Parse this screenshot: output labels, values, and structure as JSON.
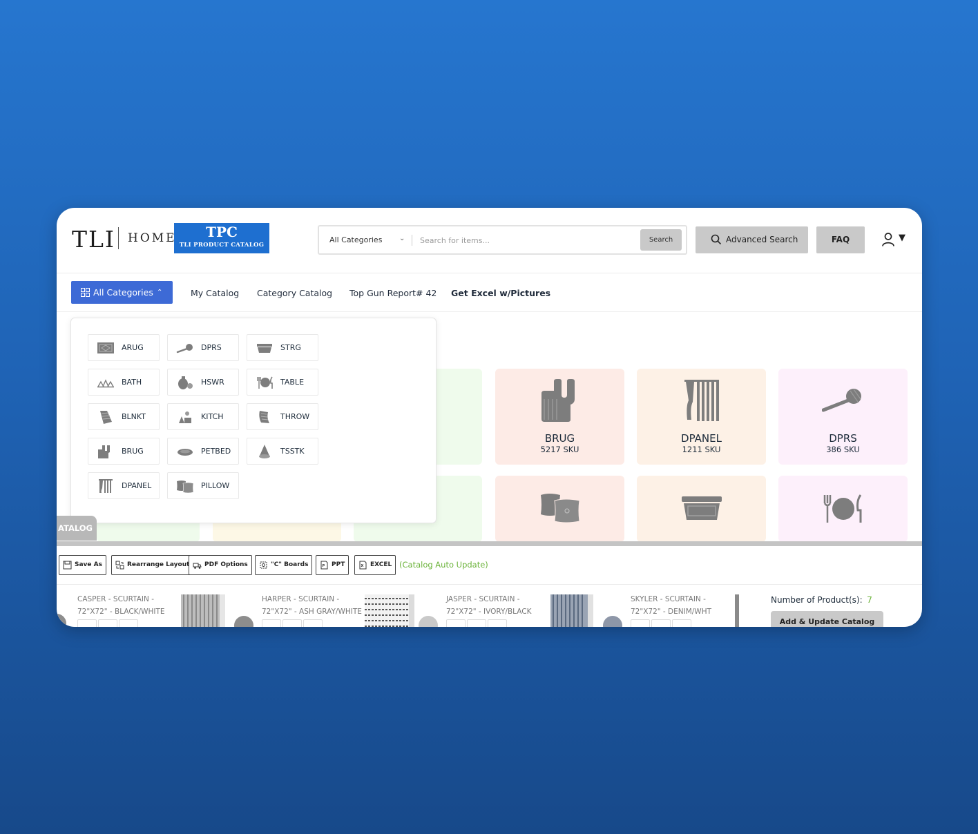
{
  "header": {
    "logo_main": "TLI",
    "logo_home": "HOME",
    "tpc_title": "TPC",
    "tpc_subtitle": "TLI PRODUCT CATALOG",
    "search": {
      "category": "All Categories",
      "placeholder": "Search for items...",
      "button": "Search"
    },
    "advanced_search": "Advanced Search",
    "faq": "FAQ",
    "user_icon": "user-icon"
  },
  "nav": {
    "all_categories": "All Categories",
    "items": [
      "My Catalog",
      "Category Catalog",
      "Top Gun Report# 42",
      "Get Excel w/Pictures"
    ]
  },
  "dropdown": {
    "items": [
      {
        "label": "ARUG",
        "icon": "rug-icon"
      },
      {
        "label": "DPRS",
        "icon": "diffuser-icon"
      },
      {
        "label": "STRG",
        "icon": "storage-bin-icon"
      },
      {
        "label": "BATH",
        "icon": "bath-set-icon"
      },
      {
        "label": "HSWR",
        "icon": "housewares-icon"
      },
      {
        "label": "TABLE",
        "icon": "tableware-icon"
      },
      {
        "label": "BLNKT",
        "icon": "blanket-icon"
      },
      {
        "label": "KITCH",
        "icon": "kitchen-icon"
      },
      {
        "label": "THROW",
        "icon": "throw-icon"
      },
      {
        "label": "BRUG",
        "icon": "bath-rug-icon"
      },
      {
        "label": "PETBED",
        "icon": "pet-bed-icon"
      },
      {
        "label": "TSSTK",
        "icon": "tree-skirt-icon"
      },
      {
        "label": "DPANEL",
        "icon": "drape-panel-icon"
      },
      {
        "label": "PILLOW",
        "icon": "pillow-icon"
      }
    ]
  },
  "cards": [
    {
      "title": "BRUG",
      "sku": "5217 SKU",
      "color": "#fdebe6"
    },
    {
      "title": "DPANEL",
      "sku": "1211 SKU",
      "color": "#fdf1e6"
    },
    {
      "title": "DPRS",
      "sku": "386 SKU",
      "color": "#fdf0fb"
    }
  ],
  "catalog_tab": "ATALOG",
  "toolbar": {
    "save_as": "Save As",
    "rearrange": "Rearrange Layout",
    "pdf_options": "PDF Options",
    "c_boards": "\"C\" Boards",
    "ppt": "PPT",
    "excel": "EXCEL",
    "auto_update": "(Catalog Auto Update)"
  },
  "products": [
    {
      "line1": "CASPER - SCURTAIN -",
      "line2": "72\"X72\" - BLACK/WHITE"
    },
    {
      "line1": "HARPER - SCURTAIN -",
      "line2": "72\"X72\" - ASH GRAY/WHITE"
    },
    {
      "line1": "JASPER - SCURTAIN -",
      "line2": "72\"X72\" - IVORY/BLACK"
    },
    {
      "line1": "SKYLER - SCURTAIN -",
      "line2": "72\"X72\" - DENIM/WHT"
    }
  ],
  "summary": {
    "label": "Number of Product(s):",
    "count": "7",
    "button": "Add & Update Catalog"
  },
  "colors": {
    "accent": "#3d6ad6",
    "brand_blue": "#1e6fd0",
    "green": "#6bb33a",
    "card_green": "#effbec",
    "card_yellow": "#fdf8e6"
  }
}
